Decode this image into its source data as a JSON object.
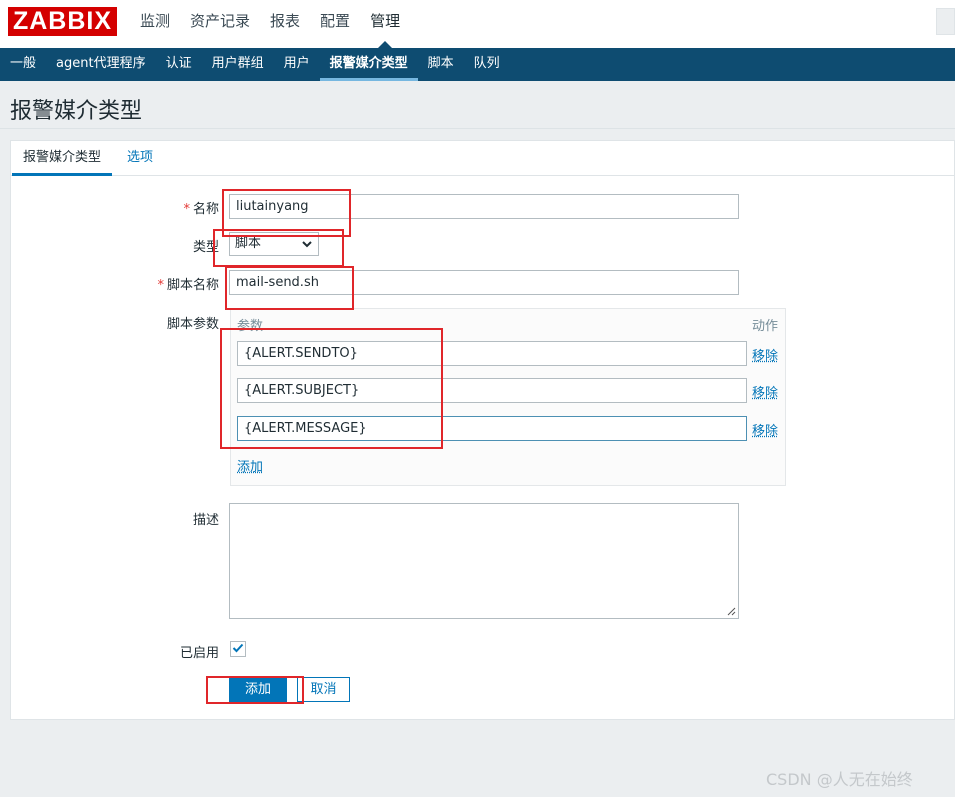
{
  "logo": "ZABBIX",
  "main_nav": [
    "监测",
    "资产记录",
    "报表",
    "配置",
    "管理"
  ],
  "main_nav_active": 4,
  "sub_nav": [
    "一般",
    "agent代理程序",
    "认证",
    "用户群组",
    "用户",
    "报警媒介类型",
    "脚本",
    "队列"
  ],
  "sub_nav_active": 5,
  "page_title": "报警媒介类型",
  "tabs": [
    "报警媒介类型",
    "选项"
  ],
  "form": {
    "name_label": "名称",
    "name_value": "liutainyang",
    "type_label": "类型",
    "type_value": "脚本",
    "script_name_label": "脚本名称",
    "script_name_value": "mail-send.sh",
    "params_label": "脚本参数",
    "params_col": "参数",
    "action_col": "动作",
    "params": [
      "{ALERT.SENDTO}",
      "{ALERT.SUBJECT}",
      "{ALERT.MESSAGE}"
    ],
    "remove_label": "移除",
    "add_param_label": "添加",
    "description_label": "描述",
    "description_value": "",
    "enabled_label": "已启用",
    "enabled": true,
    "submit_label": "添加",
    "cancel_label": "取消",
    "required_mark": "*"
  },
  "watermark": "CSDN @人无在始终",
  "colors": {
    "brand": "#d40000",
    "nav": "#0e4c71",
    "link": "#0275b8",
    "annotation": "#e0262a"
  }
}
